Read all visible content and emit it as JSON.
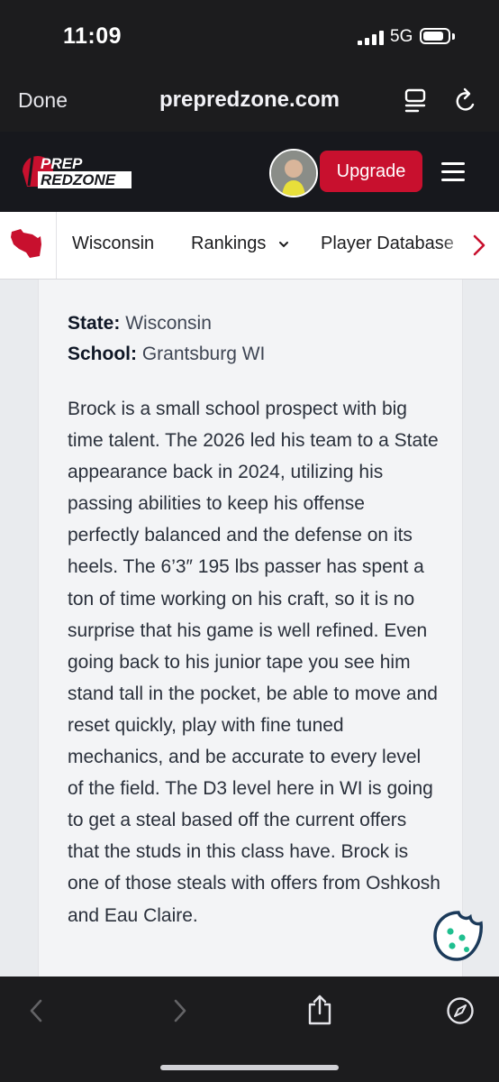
{
  "status_bar": {
    "time": "11:09",
    "network": "5G"
  },
  "browser": {
    "done_label": "Done",
    "url": "prepredzone.com"
  },
  "site": {
    "logo_line1": "PREP",
    "logo_line2": "REDZONE",
    "upgrade_label": "Upgrade",
    "accent_color": "#c8102e"
  },
  "nav": {
    "items": [
      {
        "label": "Wisconsin"
      },
      {
        "label": "Rankings"
      },
      {
        "label": "Player Database"
      }
    ]
  },
  "profile": {
    "state_label": "State:",
    "state_value": "Wisconsin",
    "school_label": "School:",
    "school_value": "Grantsburg WI",
    "bio": "Brock is a small school prospect with big time talent. The 2026 led his team to a State appearance back in 2024, utilizing his passing abilities to keep his offense perfectly balanced and the defense on its heels. The 6’3″ 195 lbs passer has spent a ton of time working on his craft, so it is no surprise that his game is well refined. Even going back to his junior tape you see him stand tall in the pocket, be able to move and reset quickly, play with fine tuned mechanics, and be accurate to every level of the field. The D3 level here in WI is going to get a steal based off the current offers that the studs in this class have. Brock is one of those steals with offers from Oshkosh and Eau Claire."
  },
  "icons": {
    "signal": "signal-bars-icon",
    "battery": "battery-icon",
    "reader": "reader-mode-icon",
    "reload": "reload-icon",
    "menu": "hamburger-menu-icon",
    "cookie": "cookie-icon",
    "back": "chevron-left-icon",
    "forward": "chevron-right-icon",
    "share": "share-icon",
    "compass": "compass-icon"
  }
}
